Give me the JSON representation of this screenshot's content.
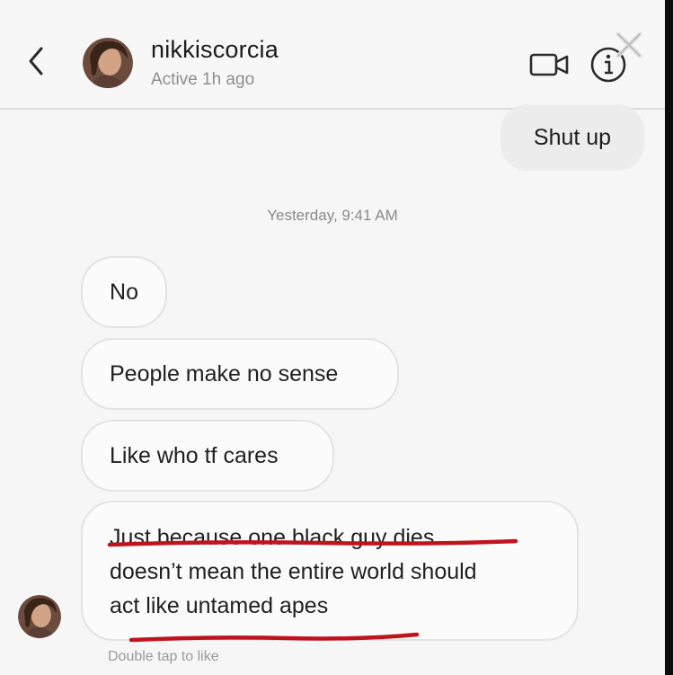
{
  "header": {
    "username": "nikkiscorcia",
    "status": "Active 1h ago"
  },
  "icons": {
    "back": "chevron-left-icon",
    "video": "video-camera-icon",
    "info": "info-circle-icon",
    "close": "close-icon"
  },
  "messages": {
    "outgoing": [
      "Shut up"
    ],
    "timestamp": "Yesterday, 9:41 AM",
    "incoming": [
      {
        "text": "No"
      },
      {
        "text": "People make no sense"
      },
      {
        "text": "Like who tf cares"
      },
      {
        "lines": [
          "Just because one black guy dies",
          "doesn’t mean the entire world should",
          "act like untamed apes"
        ]
      }
    ],
    "hint": "Double tap to like"
  },
  "colors": {
    "annotation_red": "#c0141c",
    "bubble_outgoing": "#ececec",
    "muted_text": "#8e8e8e"
  }
}
